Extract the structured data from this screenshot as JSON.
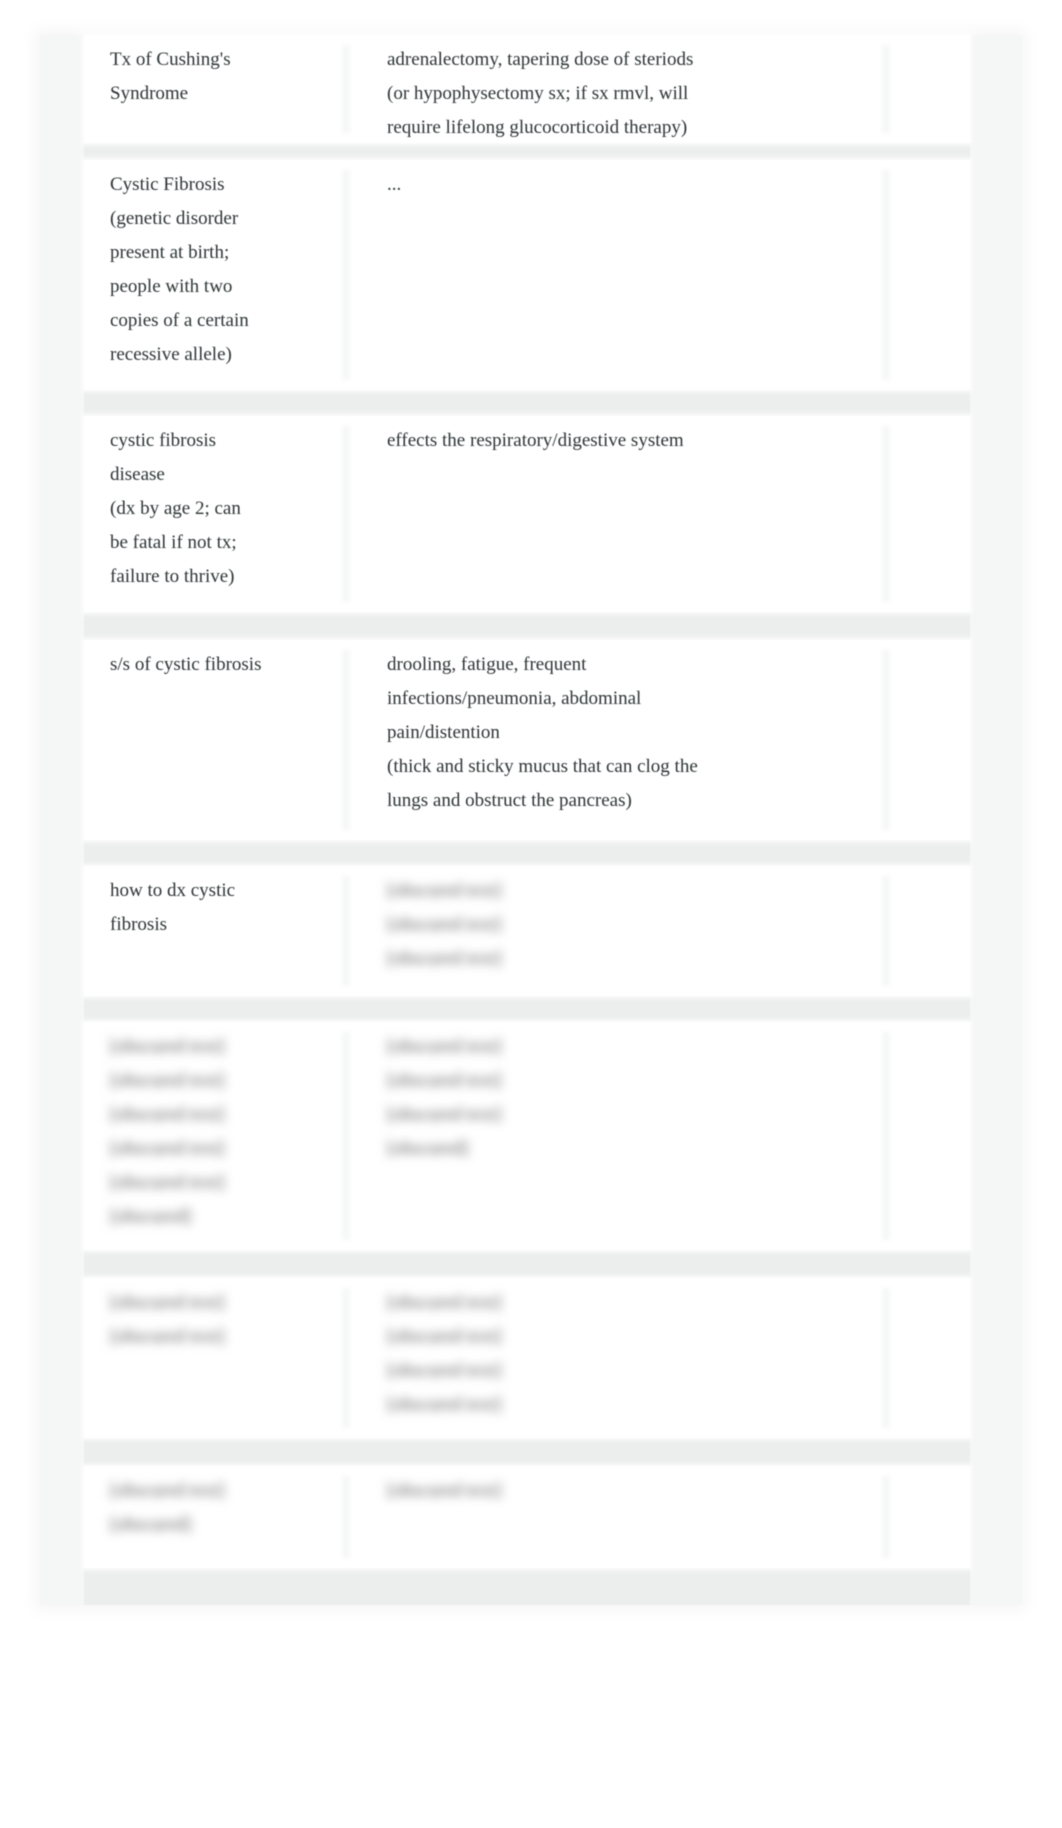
{
  "flashcards": [
    {
      "term": "Tx of Cushing's\nSyndrome",
      "definition": "adrenalectomy, tapering dose of steriods\n(or hypophysectomy sx; if sx rmvl, will\nrequire lifelong glucocorticoid therapy)",
      "obscured": false
    },
    {
      "term": "Cystic Fibrosis\n(genetic disorder\npresent at birth;\npeople with two\ncopies of a certain\nrecessive allele)",
      "definition": "...",
      "obscured": false
    },
    {
      "term": "cystic fibrosis\ndisease\n(dx by age 2; can\nbe fatal if not tx;\nfailure to thrive)",
      "definition": "effects the respiratory/digestive system",
      "obscured": false
    },
    {
      "term": "s/s of cystic fibrosis",
      "definition": "drooling, fatigue, frequent\ninfections/pneumonia, abdominal\npain/distention\n(thick and sticky mucus that can clog the\nlungs and obstruct the pancreas)",
      "obscured": false
    },
    {
      "term": "how to dx cystic\nfibrosis",
      "definition": "[obscured text]\n[obscured text]\n[obscured text]",
      "obscured": "definition"
    },
    {
      "term": "[obscured text]\n[obscured text]\n[obscured text]\n[obscured text]\n[obscured text]\n[obscured]",
      "definition": "[obscured text]\n[obscured text]\n[obscured text]\n[obscured]",
      "obscured": true
    },
    {
      "term": "[obscured text]\n[obscured text]",
      "definition": "[obscured text]\n[obscured text]\n[obscured text]\n[obscured text]",
      "obscured": true
    },
    {
      "term": "[obscured text]\n[obscured]",
      "definition": "[obscured text]",
      "obscured": true
    }
  ]
}
